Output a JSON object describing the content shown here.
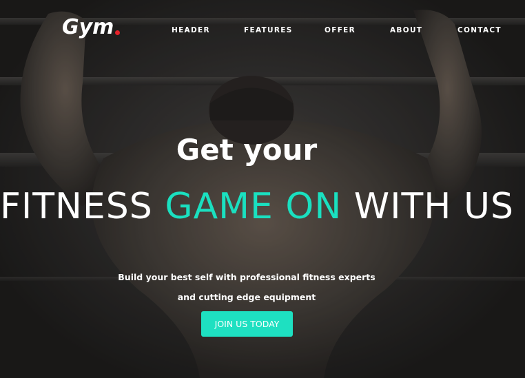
{
  "brand": {
    "name": "Gym",
    "dot_color": "#e4222a"
  },
  "nav": {
    "items": [
      {
        "label": "HEADER"
      },
      {
        "label": "FEATURES"
      },
      {
        "label": "OFFER"
      },
      {
        "label": "ABOUT"
      },
      {
        "label": "CONTACT"
      }
    ]
  },
  "hero": {
    "headline_top": "Get your",
    "headline_bottom": {
      "part1": "FITNESS ",
      "accent": "GAME ON",
      "part2": " WITH US"
    },
    "subtitle_line1": "Build your best self with professional fitness experts",
    "subtitle_line2": "and cutting edge equipment",
    "cta_label": "JOIN US TODAY"
  },
  "colors": {
    "accent": "#1ae0c0",
    "cta_background": "#1ee0c1",
    "text": "#ffffff"
  }
}
